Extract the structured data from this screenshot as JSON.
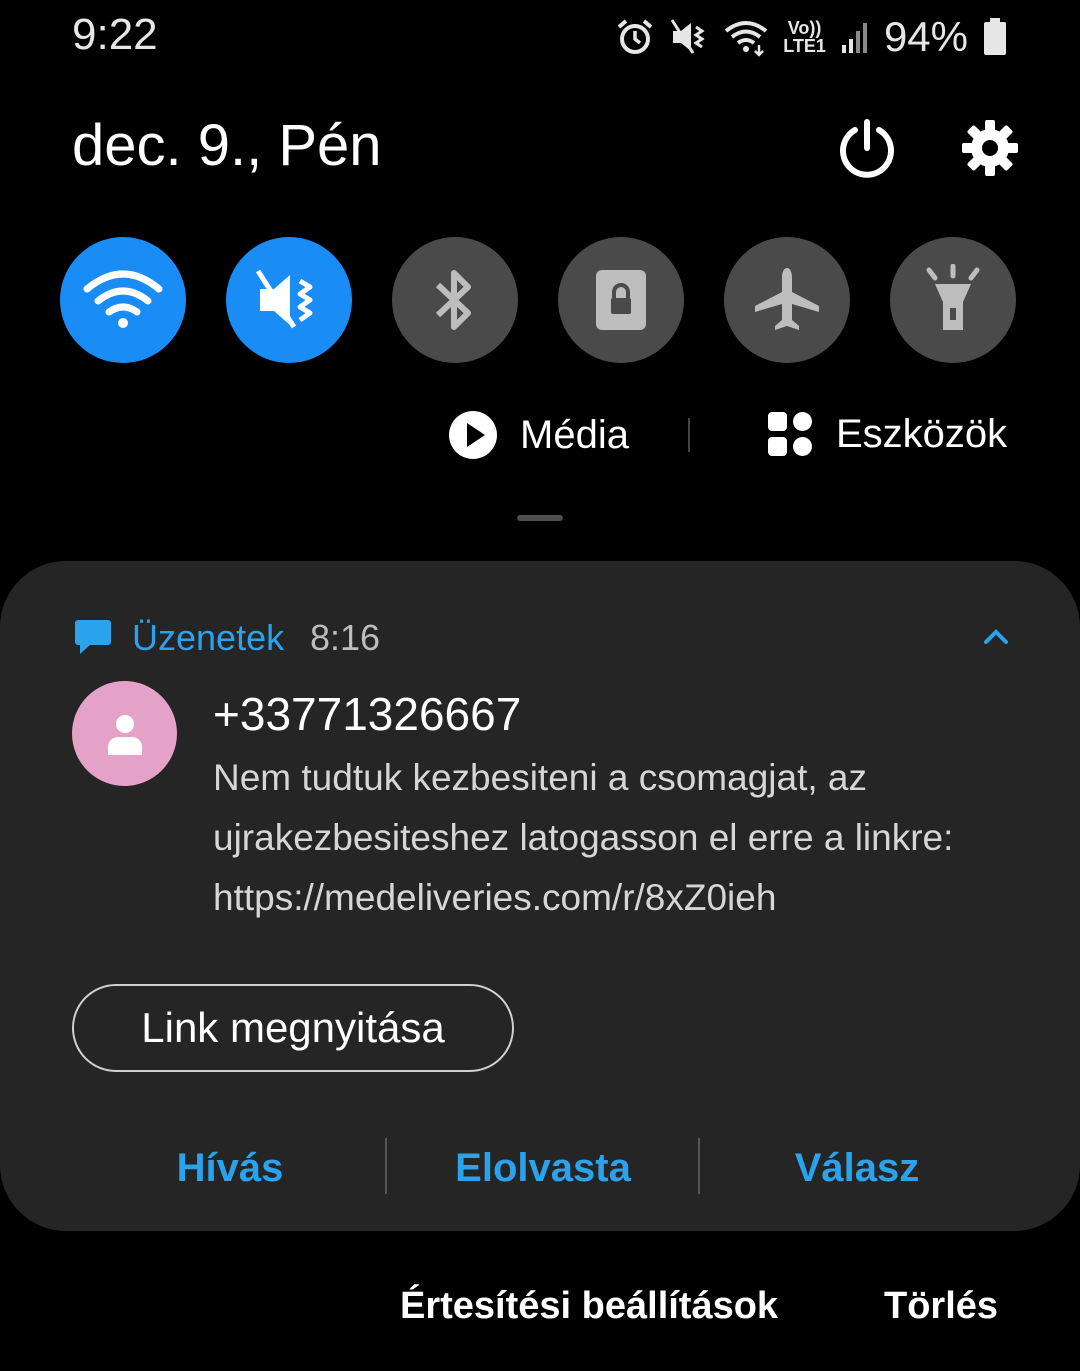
{
  "status_bar": {
    "time": "9:22",
    "signal_label_top": "Vo))",
    "signal_label_bottom": "LTE1",
    "battery_percent": "94%",
    "icons": [
      "alarm-icon",
      "vibrate-mute-icon",
      "wifi-icon",
      "volte-icon",
      "signal-icon",
      "battery-icon"
    ]
  },
  "header": {
    "date": "dec. 9., Pén",
    "icons": [
      "power-icon",
      "gear-icon"
    ]
  },
  "quick_settings": [
    {
      "name": "wifi",
      "icon": "wifi-icon",
      "state": "on"
    },
    {
      "name": "mute",
      "icon": "vibrate-mute-icon",
      "state": "on"
    },
    {
      "name": "bluetooth",
      "icon": "bluetooth-icon",
      "state": "off"
    },
    {
      "name": "rotation-lock",
      "icon": "rotation-lock-icon",
      "state": "off"
    },
    {
      "name": "airplane",
      "icon": "airplane-icon",
      "state": "off"
    },
    {
      "name": "flashlight",
      "icon": "flashlight-icon",
      "state": "off"
    }
  ],
  "media_bar": {
    "media_label": "Média",
    "devices_label": "Eszközök"
  },
  "notification": {
    "app_name": "Üzenetek",
    "time": "8:16",
    "sender": "+33771326667",
    "message": "Nem tudtuk kezbesiteni a csomagjat, az ujrakezbesiteshez latogasson el erre a linkre: https://medeliveries.com/r/8xZ0ieh",
    "link_button": "Link megnyitása",
    "actions": {
      "call": "Hívás",
      "mark_read": "Elolvasta",
      "reply": "Válasz"
    }
  },
  "footer": {
    "settings": "Értesítési beállítások",
    "clear": "Törlés"
  },
  "colors": {
    "accent_blue": "#2aa3ec",
    "toggle_on": "#1a8cf5",
    "toggle_off": "#4a4a4a",
    "card_bg": "#252525",
    "avatar_bg": "#e5a2c8"
  }
}
